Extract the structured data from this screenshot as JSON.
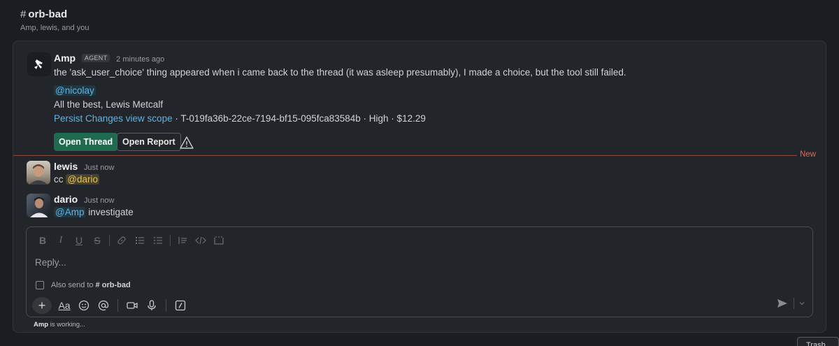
{
  "channel": {
    "hash": "#",
    "name": "orb-bad",
    "members": "Amp, lewis, and you"
  },
  "messages": {
    "amp": {
      "author": "Amp",
      "badge": "AGENT",
      "time": "2 minutes ago",
      "text": "the 'ask_user_choice' thing appeared when i came back to the thread (it was asleep presumably), I made a choice, but the tool still failed.",
      "mention": "@nicolay",
      "signoff": "All the best, Lewis Metcalf",
      "link": "Persist Changes view scope",
      "meta": " · T-019fa36b-22ce-7194-bf15-095fca83584b · High · $12.29",
      "open_thread": "Open Thread",
      "open_report": "Open Report"
    },
    "new_label": "New",
    "lewis": {
      "author": "lewis",
      "time": "Just now",
      "prefix": "cc ",
      "mention": "@dario"
    },
    "dario": {
      "author": "dario",
      "time": "Just now",
      "mention": "@Amp",
      "text": " investigate"
    }
  },
  "composer": {
    "placeholder": "Reply...",
    "also_send": "Also send to",
    "also_send_channel": "# orb-bad",
    "aa_label": "Aa"
  },
  "status": {
    "who": "Amp",
    "text": " is working..."
  },
  "trash_button": "Trash"
}
